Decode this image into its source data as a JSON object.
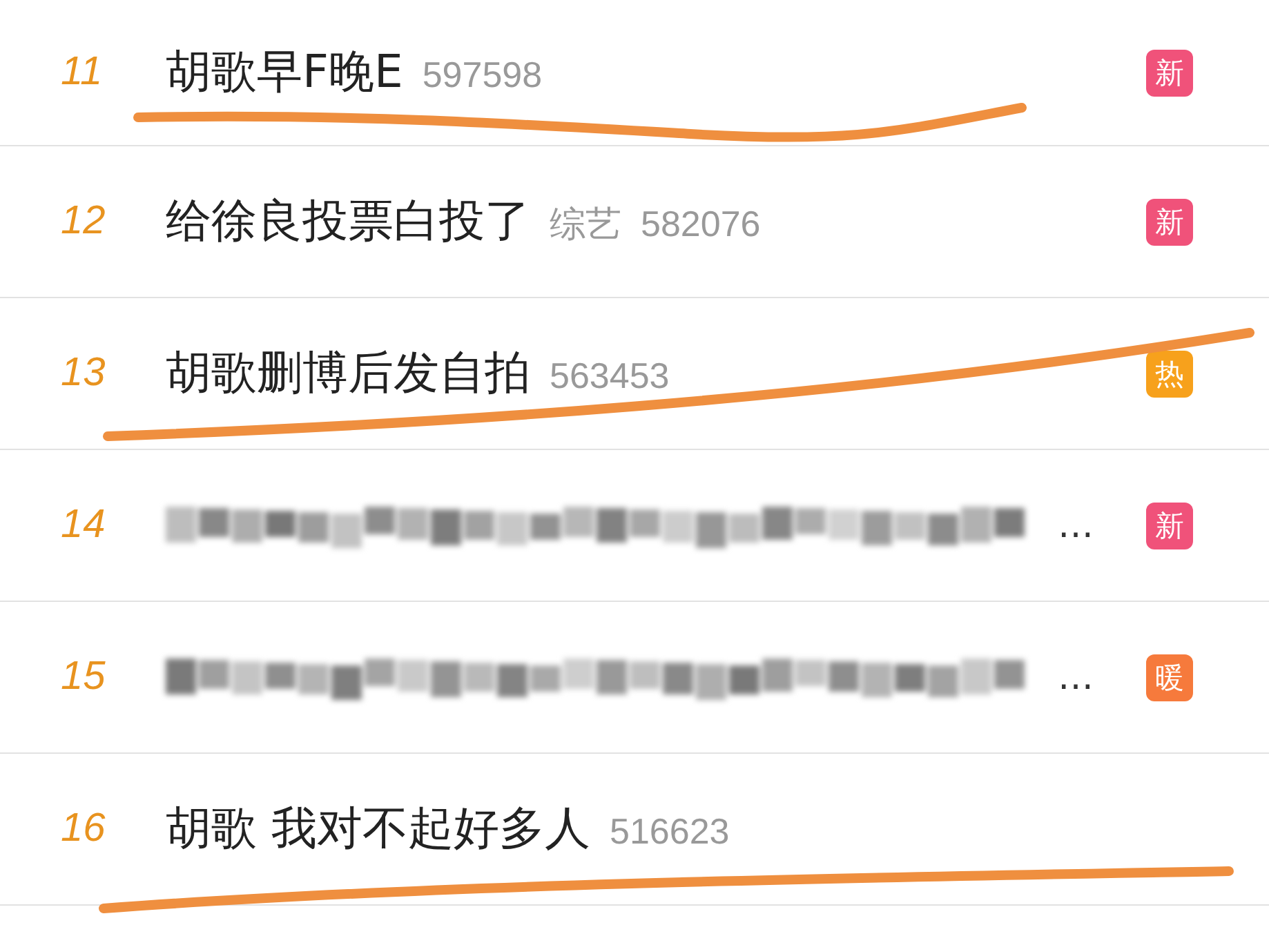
{
  "rows": [
    {
      "rank": "11",
      "kind": "topic",
      "title": "胡歌早F晚E",
      "count": "597598",
      "badge": {
        "label": "新",
        "color": "#f0527a"
      },
      "underlined": true
    },
    {
      "rank": "12",
      "kind": "topic",
      "title": "给徐良投票白投了",
      "category": "综艺",
      "count": "582076",
      "badge": {
        "label": "新",
        "color": "#f0527a"
      },
      "underlined": false
    },
    {
      "rank": "13",
      "kind": "topic",
      "title": "胡歌删博后发自拍",
      "count": "563453",
      "badge": {
        "label": "热",
        "color": "#f7a11c"
      },
      "underlined": true
    },
    {
      "rank": "14",
      "kind": "blurred",
      "ellipsis": "…",
      "badge": {
        "label": "新",
        "color": "#f0527a"
      },
      "underlined": false
    },
    {
      "rank": "15",
      "kind": "blurred",
      "ellipsis": "…",
      "badge": {
        "label": "暖",
        "color": "#f67a3c"
      },
      "underlined": false
    },
    {
      "rank": "16",
      "kind": "topic",
      "title": "胡歌 我对不起好多人",
      "count": "516623",
      "underlined": true
    }
  ]
}
